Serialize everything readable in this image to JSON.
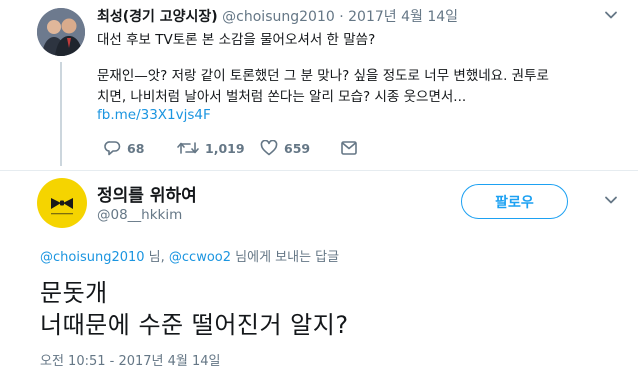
{
  "parent_tweet": {
    "author_name": "최성(경기 고양시장)",
    "handle": "@choisung2010",
    "separator": "·",
    "date": "2017년 4월 14일",
    "text_line1": "대선 후보 TV토론 본 소감을 물어오셔서 한 말씀?",
    "text_line2": "문재인—앗? 저랑 같이 토론했던 그 분 맞나? 싶을 정도로 너무 변했네요. 권투로",
    "text_line3": "치면, 나비처럼 날아서 벌처럼 쏜다는 알리 모습? 시종 웃으면서...",
    "link": "fb.me/33X1vjs4F",
    "reply_count": "68",
    "retweet_count": "1,019",
    "like_count": "659"
  },
  "main_tweet": {
    "author_name": "정의를 위하여",
    "handle": "@08__hkkim",
    "follow_label": "팔로우",
    "reply_mention1": "@choisung2010",
    "reply_mid": " 님, ",
    "reply_mention2": "@ccwoo2",
    "reply_suffix": " 님에게 보내는 답글",
    "text_line1": "문돗개",
    "text_line2": "너때문에 수준 떨어진거 알지?",
    "timestamp": "오전 10:51 - 2017년 4월 14일"
  },
  "icons": {
    "reply": "reply-icon",
    "retweet": "retweet-icon",
    "like": "heart-icon",
    "dm": "message-icon",
    "caret": "chevron-down-icon"
  },
  "colors": {
    "link": "#1b95e0",
    "accent": "#1da1f2",
    "muted": "#657786",
    "avatar_yellow": "#f5d400"
  }
}
